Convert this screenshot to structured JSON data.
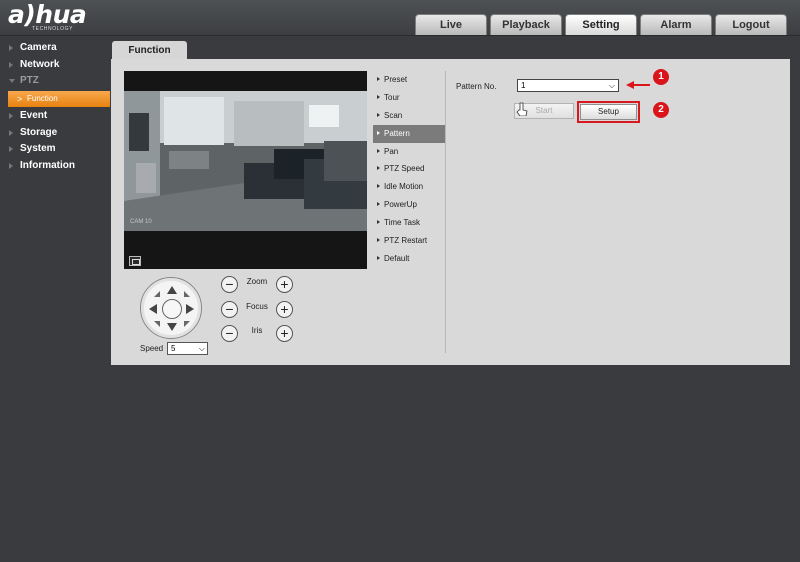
{
  "brand": {
    "name": "a)hua",
    "tagline": "TECHNOLOGY"
  },
  "nav": {
    "tabs": [
      "Live",
      "Playback",
      "Setting",
      "Alarm",
      "Logout"
    ],
    "active": "Setting"
  },
  "sidebar": {
    "items": [
      "Camera",
      "Network",
      "PTZ",
      "Event",
      "Storage",
      "System",
      "Information"
    ],
    "sub_item": "Function"
  },
  "content": {
    "tab": "Function",
    "video": {
      "cam_label": "CAM 10"
    },
    "ptz": {
      "speed_label": "Speed",
      "speed_value": "5",
      "zoom_label": "Zoom",
      "focus_label": "Focus",
      "iris_label": "Iris"
    },
    "menu": [
      "Preset",
      "Tour",
      "Scan",
      "Pattern",
      "Pan",
      "PTZ Speed",
      "Idle Motion",
      "PowerUp",
      "Time Task",
      "PTZ Restart",
      "Default"
    ],
    "menu_active": "Pattern",
    "pattern": {
      "label": "Pattern No.",
      "value": "1",
      "start_label": "Start",
      "setup_label": "Setup"
    },
    "annotations": [
      "1",
      "2"
    ]
  },
  "colors": {
    "accent": "#e8820f",
    "annotation": "#d9141a",
    "menu_active": "#7b7b7b"
  }
}
